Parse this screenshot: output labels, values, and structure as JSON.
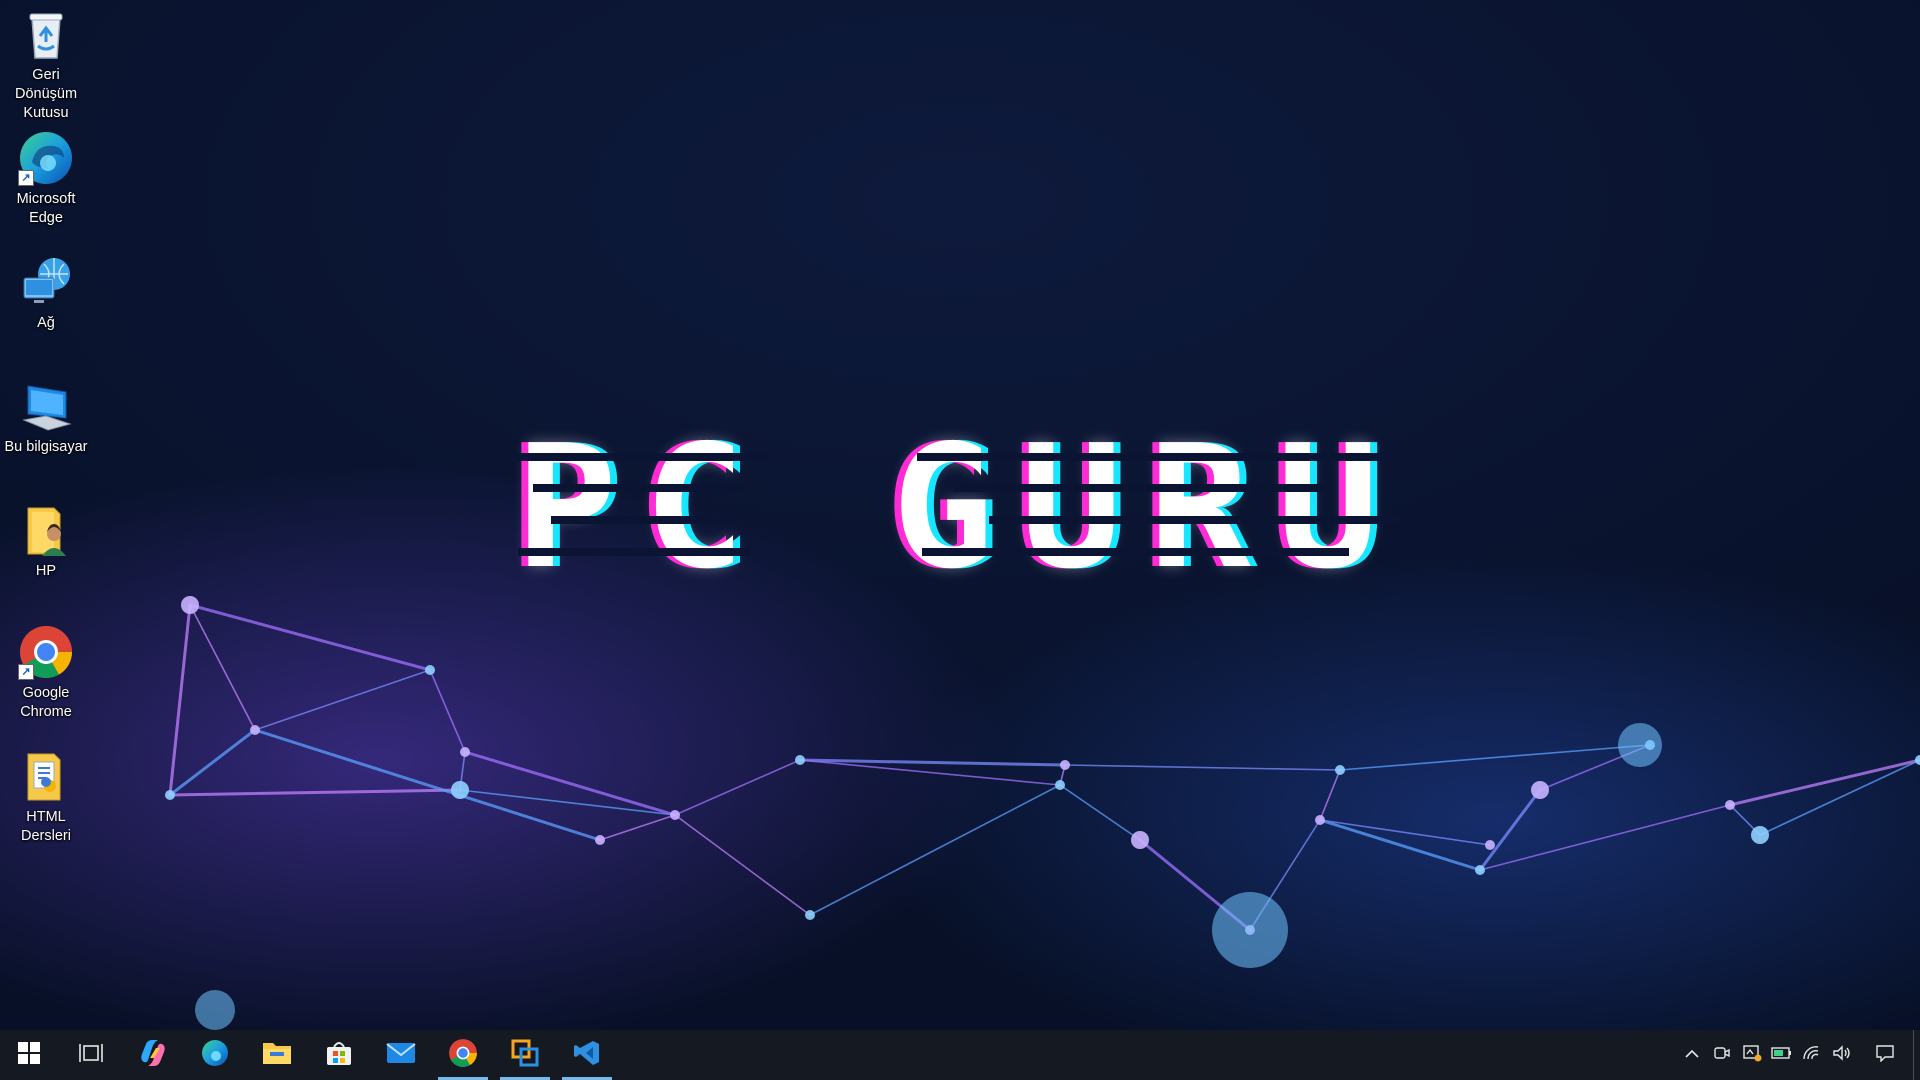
{
  "desktop": {
    "icons": [
      {
        "label": "Geri Dönüşüm Kutusu",
        "icon": "recycle-bin-icon"
      },
      {
        "label": "Microsoft Edge",
        "icon": "edge-icon"
      },
      {
        "label": "Ağ",
        "icon": "network-icon"
      },
      {
        "label": "Bu bilgisayar",
        "icon": "this-pc-icon"
      },
      {
        "label": "HP",
        "icon": "user-folder-icon"
      },
      {
        "label": "Google Chrome",
        "icon": "chrome-icon"
      },
      {
        "label": "HTML Dersleri",
        "icon": "folder-icon"
      }
    ],
    "wallpaper_text": "PC GURU"
  },
  "wallpaper_words": [
    "PC",
    "GURU"
  ],
  "taskbar": {
    "apps": [
      {
        "icon": "start-icon",
        "active": false
      },
      {
        "icon": "task-view-icon",
        "active": false
      },
      {
        "icon": "copilot-icon",
        "active": false
      },
      {
        "icon": "edge-icon",
        "active": false
      },
      {
        "icon": "file-explorer-icon",
        "active": false
      },
      {
        "icon": "microsoft-store-icon",
        "active": false
      },
      {
        "icon": "mail-icon",
        "active": false
      },
      {
        "icon": "chrome-icon",
        "active": true
      },
      {
        "icon": "virtualbox-icon",
        "active": true
      },
      {
        "icon": "vscode-icon",
        "active": true
      }
    ],
    "tray": [
      "chevron-up-icon",
      "meet-now-icon",
      "defender-icon",
      "battery-icon",
      "wifi-icon",
      "volume-icon",
      "notifications-icon"
    ]
  },
  "colors": {
    "accent": "#76b9ed",
    "taskbar": "#151a22",
    "glitch_magenta": "#ff2bd6",
    "glitch_cyan": "#16e6ff"
  }
}
